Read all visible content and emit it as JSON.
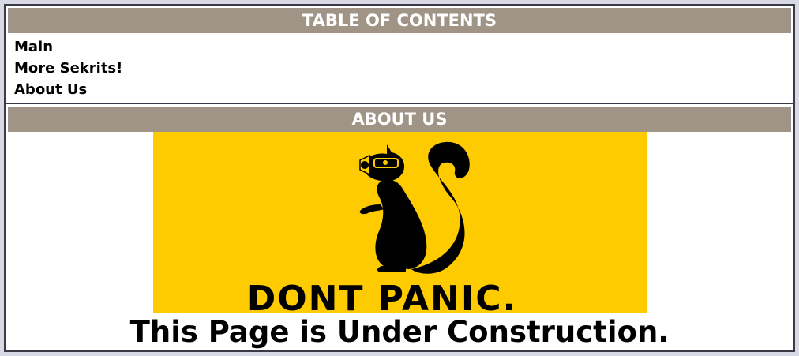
{
  "toc": {
    "title": "TABLE OF CONTENTS",
    "items": [
      {
        "label": "Main"
      },
      {
        "label": "More Sekrits!"
      },
      {
        "label": "About Us"
      }
    ]
  },
  "about": {
    "title": "ABOUT US",
    "banner": {
      "text": "DONT PANIC.",
      "background": "#fecb00",
      "icon": "squirrel-gas-mask-icon"
    },
    "notice": "This Page is Under Construction."
  },
  "colors": {
    "header_bg": "#a09486",
    "border": "#3a3a48",
    "page_bg": "#d9d9e6"
  }
}
